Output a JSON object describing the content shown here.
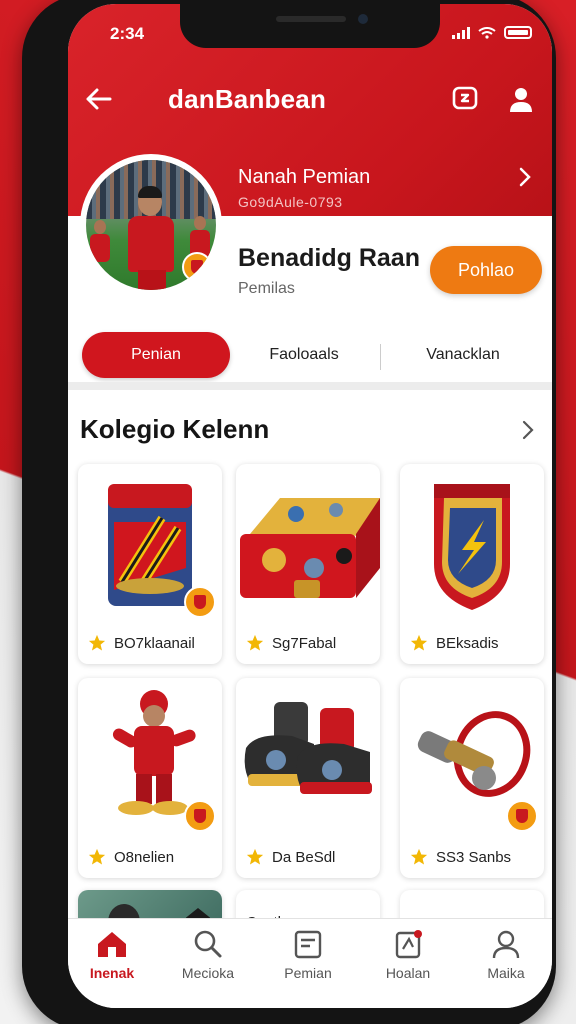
{
  "status_bar": {
    "time": "2:34"
  },
  "header": {
    "title": "danBanbean"
  },
  "profile": {
    "name": "Nanah Pemian",
    "id": "Go9dAule-0793",
    "display_name": "Benadidg Raan",
    "subtitle": "Pemilas",
    "action_label": "Pohlao"
  },
  "tabs": [
    {
      "label": "Penian",
      "active": true
    },
    {
      "label": "Faoloaals",
      "active": false
    },
    {
      "label": "Vanacklan",
      "active": false
    }
  ],
  "collection": {
    "title": "Kolegio Kelenn",
    "items": [
      {
        "label": "BO7klaanail",
        "icon": "card-pack-icon"
      },
      {
        "label": "Sg7Fabal",
        "icon": "chest-icon"
      },
      {
        "label": "BEksadis",
        "icon": "shield-badge-icon"
      },
      {
        "label": "O8nelien",
        "icon": "mascot-figure-icon"
      },
      {
        "label": "Da BeSdl",
        "icon": "boots-icon"
      },
      {
        "label": "SS3 Sanbs",
        "icon": "whistle-icon"
      }
    ],
    "partial_label": "Caath"
  },
  "bottom_nav": [
    {
      "label": "Inenak",
      "icon": "home-icon",
      "active": true
    },
    {
      "label": "Mecioka",
      "icon": "search-icon",
      "active": false
    },
    {
      "label": "Pemian",
      "icon": "folder-icon",
      "active": false
    },
    {
      "label": "Hoalan",
      "icon": "notification-icon",
      "active": false
    },
    {
      "label": "Maika",
      "icon": "profile-icon",
      "active": false
    }
  ],
  "colors": {
    "primary_red": "#d0161e",
    "accent_orange": "#ee7a12",
    "badge_gold": "#f39c12"
  }
}
